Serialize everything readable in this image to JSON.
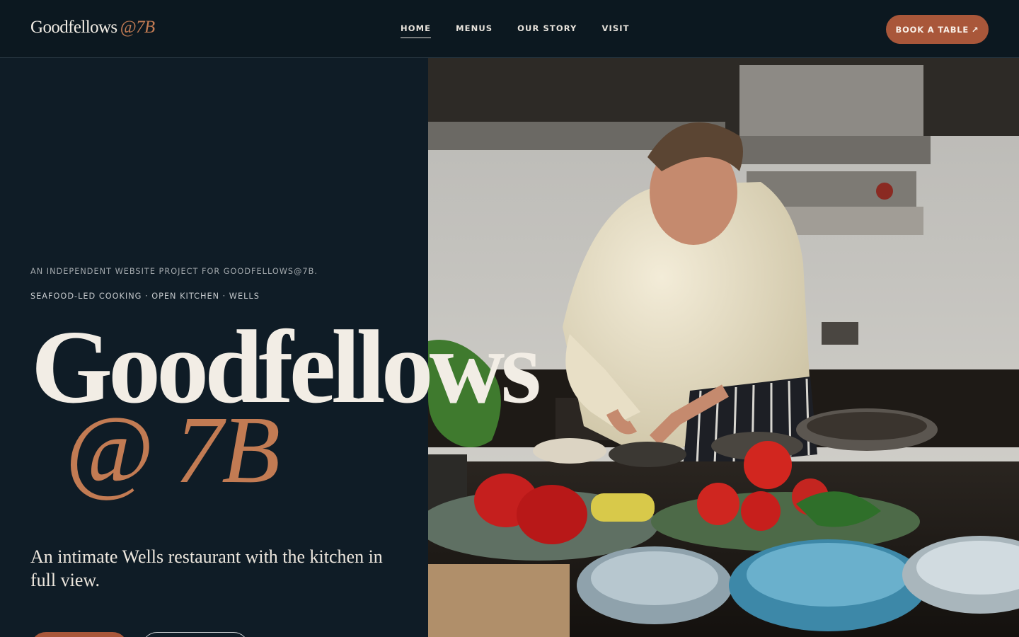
{
  "header": {
    "brand_name": "Goodfellows",
    "brand_suffix": "@7B",
    "nav": [
      {
        "label": "HOME",
        "active": true
      },
      {
        "label": "MENUS",
        "active": false
      },
      {
        "label": "OUR STORY",
        "active": false
      },
      {
        "label": "VISIT",
        "active": false
      }
    ],
    "book_label": "BOOK A TABLE",
    "book_icon": "↗"
  },
  "hero": {
    "eyebrow": "AN INDEPENDENT WEBSITE PROJECT FOR GOODFELLOWS@7B.",
    "subtitle": "SEAFOOD-LED COOKING · OPEN KITCHEN · WELLS",
    "title": "Goodfellows",
    "title_suffix": "@ 7B",
    "tagline": "An intimate Wells restaurant with the kitchen in full view.",
    "image_icon": "chef-photo"
  },
  "colors": {
    "background": "#0f1c26",
    "accent": "#a9573a",
    "accent_text": "#c27b53",
    "text": "#f1ece4"
  }
}
